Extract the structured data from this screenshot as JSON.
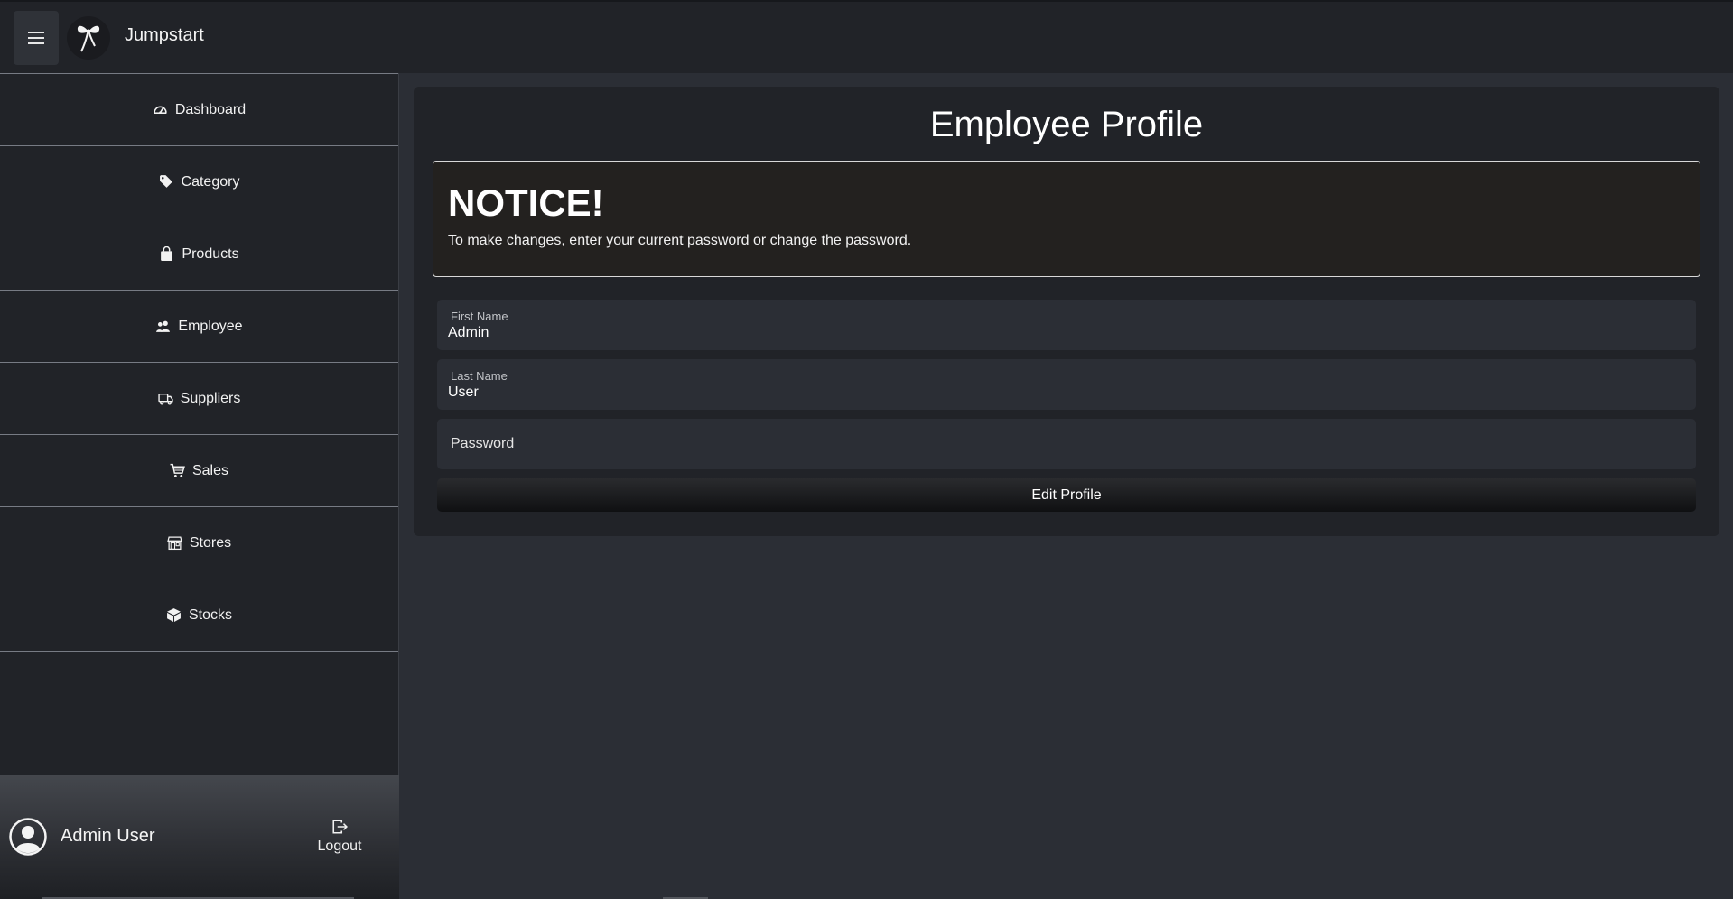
{
  "header": {
    "menu_icon": "hamburger-icon",
    "logo_icon": "bow-logo-icon",
    "brand": "Jumpstart"
  },
  "sidebar": {
    "items": [
      {
        "label": "Dashboard",
        "icon": "speedometer-icon"
      },
      {
        "label": "Category",
        "icon": "tags-icon"
      },
      {
        "label": "Products",
        "icon": "bag-icon"
      },
      {
        "label": "Employee",
        "icon": "people-icon"
      },
      {
        "label": "Suppliers",
        "icon": "truck-icon"
      },
      {
        "label": "Sales",
        "icon": "cart-icon"
      },
      {
        "label": "Stores",
        "icon": "shop-icon"
      },
      {
        "label": "Stocks",
        "icon": "box-icon"
      }
    ],
    "user": {
      "name": "Admin User",
      "avatar_icon": "person-circle-icon",
      "logout_label": "Logout",
      "logout_icon": "box-arrow-right-icon"
    }
  },
  "main": {
    "title": "Employee Profile",
    "notice": {
      "title": "NOTICE!",
      "text": "To make changes, enter your current password or change the password."
    },
    "form": {
      "first_name": {
        "label": "First Name",
        "value": "Admin"
      },
      "last_name": {
        "label": "Last Name",
        "value": "User"
      },
      "password": {
        "placeholder": "Password",
        "value": ""
      },
      "submit_label": "Edit Profile"
    }
  },
  "colors": {
    "background": "#2b2e35",
    "panel": "#212328",
    "divider": "#777b84",
    "text": "#ffffff"
  }
}
